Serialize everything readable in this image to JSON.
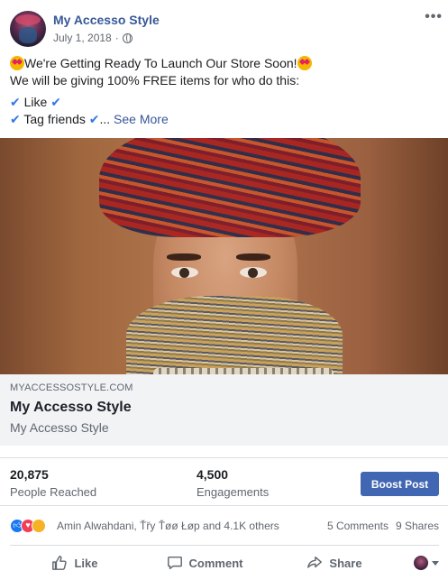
{
  "post": {
    "page_name": "My Accesso Style",
    "date": "July 1, 2018",
    "dot": "·",
    "more_icon": "•••",
    "text": {
      "line1": "We're Getting Ready To Launch Our Store Soon!",
      "line2": "We will be giving 100% FREE items for who do this:",
      "line3": "Like",
      "line4_text": "Tag friends",
      "ellipsis": "...",
      "see_more": "See More",
      "check": "✔"
    }
  },
  "link_preview": {
    "domain": "MYACCESSOSTYLE.COM",
    "title": "My Accesso Style",
    "description": "My Accesso Style"
  },
  "stats": {
    "reached_value": "20,875",
    "reached_label": "People Reached",
    "engagements_value": "4,500",
    "engagements_label": "Engagements",
    "boost_label": "Boost Post"
  },
  "reactions": {
    "names": "Amin Alwahdani, Ťřy Ťøø Łøp and 4.1K others",
    "comments": "5 Comments",
    "shares": "9 Shares"
  },
  "actions": {
    "like": "Like",
    "comment": "Comment",
    "share": "Share"
  },
  "colors": {
    "brand_blue": "#385898",
    "button_blue": "#4267b2",
    "check_blue": "#3578e5"
  }
}
